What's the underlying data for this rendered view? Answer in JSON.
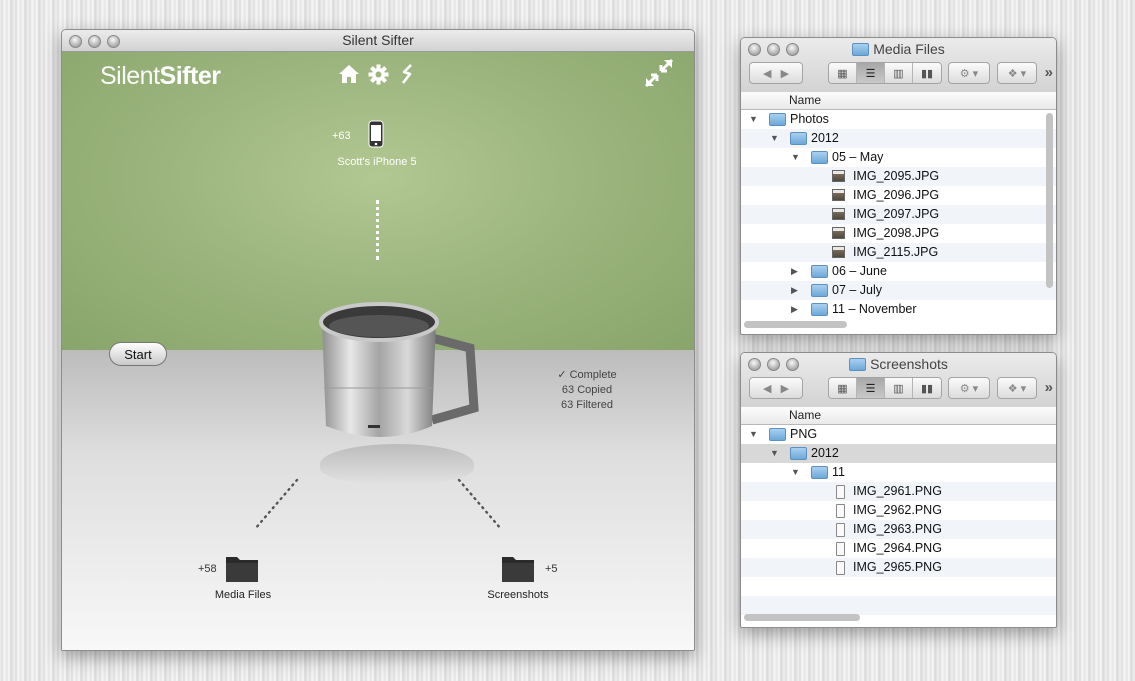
{
  "sifter": {
    "window_title": "Silent Sifter",
    "logo_thin": "Silent",
    "logo_bold": "Sifter",
    "device_count": "+63",
    "device_name": "Scott's iPhone 5",
    "start_label": "Start",
    "status": [
      "✓ Complete",
      "63 Copied",
      "63 Filtered"
    ],
    "media_count": "+58",
    "media_label": "Media Files",
    "screens_count": "+5",
    "screens_label": "Screenshots"
  },
  "media_window": {
    "title": "Media Files",
    "column_name": "Name",
    "rows": [
      {
        "label": "Photos",
        "level": 0,
        "kind": "folder",
        "disclosure": "open"
      },
      {
        "label": "2012",
        "level": 1,
        "kind": "folder",
        "disclosure": "open"
      },
      {
        "label": "05 – May",
        "level": 2,
        "kind": "folder",
        "disclosure": "open"
      },
      {
        "label": "IMG_2095.JPG",
        "level": 3,
        "kind": "jpg",
        "disclosure": "none"
      },
      {
        "label": "IMG_2096.JPG",
        "level": 3,
        "kind": "jpg",
        "disclosure": "none"
      },
      {
        "label": "IMG_2097.JPG",
        "level": 3,
        "kind": "jpg",
        "disclosure": "none"
      },
      {
        "label": "IMG_2098.JPG",
        "level": 3,
        "kind": "jpg",
        "disclosure": "none"
      },
      {
        "label": "IMG_2115.JPG",
        "level": 3,
        "kind": "jpg",
        "disclosure": "none"
      },
      {
        "label": "06 – June",
        "level": 2,
        "kind": "folder",
        "disclosure": "closed"
      },
      {
        "label": "07 – July",
        "level": 2,
        "kind": "folder",
        "disclosure": "closed"
      },
      {
        "label": "11 – November",
        "level": 2,
        "kind": "folder",
        "disclosure": "closed"
      }
    ]
  },
  "screens_window": {
    "title": "Screenshots",
    "column_name": "Name",
    "rows": [
      {
        "label": "PNG",
        "level": 0,
        "kind": "folder",
        "disclosure": "open"
      },
      {
        "label": "2012",
        "level": 1,
        "kind": "folder",
        "disclosure": "open",
        "selected": true
      },
      {
        "label": "11",
        "level": 2,
        "kind": "folder",
        "disclosure": "open"
      },
      {
        "label": "IMG_2961.PNG",
        "level": 3,
        "kind": "png",
        "disclosure": "none"
      },
      {
        "label": "IMG_2962.PNG",
        "level": 3,
        "kind": "png",
        "disclosure": "none"
      },
      {
        "label": "IMG_2963.PNG",
        "level": 3,
        "kind": "png",
        "disclosure": "none"
      },
      {
        "label": "IMG_2964.PNG",
        "level": 3,
        "kind": "png",
        "disclosure": "none"
      },
      {
        "label": "IMG_2965.PNG",
        "level": 3,
        "kind": "png",
        "disclosure": "none"
      }
    ]
  },
  "icons": {
    "home": "home-icon",
    "settings": "gear-icon",
    "sift": "sift-icon",
    "fullscreen": "fullscreen-icon",
    "device": "iphone-icon",
    "folder": "folder-icon"
  }
}
